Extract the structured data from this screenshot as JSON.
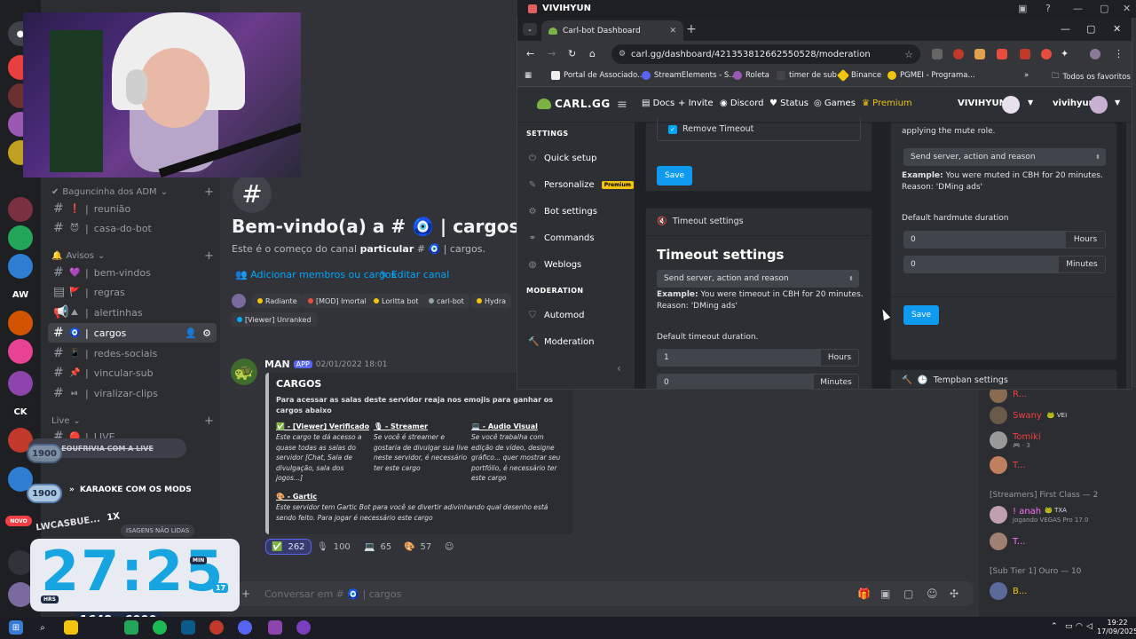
{
  "stream_bar": {
    "title": "VIVIHYUN"
  },
  "chrome": {
    "tab_title": "Carl-bot Dashboard",
    "url": "carl.gg/dashboard/421353812662550528/moderation",
    "bookmarks": [
      "Portal de Associado...",
      "StreamElements - S...",
      "Roleta",
      "timer de sub",
      "Binance",
      "PGMEI - Programa..."
    ],
    "all_bookmarks": "Todos os favoritos"
  },
  "carl": {
    "logo": "CARL.GG",
    "nav": {
      "docs": "Docs",
      "invite": "Invite",
      "discord": "Discord",
      "status": "Status",
      "games": "Games",
      "premium": "Premium"
    },
    "server_name": "VIVIHYUN",
    "user_name": "vivihyun",
    "sidebar": {
      "settings_heading": "SETTINGS",
      "items": [
        {
          "label": "Quick setup",
          "icon": "power-icon"
        },
        {
          "label": "Personalize",
          "icon": "pencil-icon",
          "badge": "Premium"
        },
        {
          "label": "Bot settings",
          "icon": "robot-icon"
        },
        {
          "label": "Commands",
          "icon": "link-icon"
        },
        {
          "label": "Weblogs",
          "icon": "globe-icon"
        }
      ],
      "moderation_heading": "MODERATION",
      "mod_items": [
        {
          "label": "Automod",
          "icon": "shield-icon"
        },
        {
          "label": "Moderation",
          "icon": "hammer-icon"
        }
      ]
    },
    "left_card": {
      "checkbox_label": "Remove Timeout",
      "save_label": "Save",
      "section_header": "Timeout settings",
      "title": "Timeout settings",
      "select_value": "Send server, action and reason",
      "example_prefix": "Example:",
      "example_text": "You were timeout in CBH for 20 minutes.",
      "example_reason": "Reason: 'DMing ads'",
      "duration_label": "Default timeout duration.",
      "hours_value": "1",
      "hours_unit": "Hours",
      "minutes_value": "0",
      "minutes_unit": "Minutes"
    },
    "right_card": {
      "intro": "applying the mute role.",
      "select_value": "Send server, action and reason",
      "example_prefix": "Example:",
      "example_text": "You were muted in CBH for 20 minutes.",
      "example_reason": "Reason: 'DMing ads'",
      "duration_label": "Default hardmute duration",
      "hours_value": "0",
      "hours_unit": "Hours",
      "minutes_value": "0",
      "minutes_unit": "Minutes",
      "save_label": "Save",
      "next_section": "Tempban settings"
    }
  },
  "discord": {
    "categories": {
      "adm": "Baguncinha dos ADM",
      "avisos": "Avisos",
      "live": "Live"
    },
    "channels_adm": [
      {
        "emoji": "❗",
        "name": "reunião"
      },
      {
        "emoji": "😈",
        "name": "casa-do-bot"
      }
    ],
    "channels_avisos": [
      {
        "emoji": "💜",
        "name": "bem-vindos"
      },
      {
        "emoji": "🚩",
        "name": "regras"
      },
      {
        "emoji": "⛰",
        "name": "alertinhas"
      },
      {
        "emoji": "🧿",
        "name": "cargos"
      },
      {
        "emoji": "📱",
        "name": "redes-sociais"
      },
      {
        "emoji": "📌",
        "name": "vincular-sub"
      },
      {
        "emoji": "⏯",
        "name": "viralizar-clips"
      }
    ],
    "channels_live": [
      {
        "emoji": "🔴",
        "name": "LIVE"
      }
    ],
    "welcome_title": "Bem-vindo(a) a # 🧿 | cargos!",
    "welcome_sub_prefix": "Este é o começo do canal",
    "welcome_sub_bold": "particular",
    "welcome_sub_suffix": "# 🧿 | cargos.",
    "add_members": "Adicionar membros ou cargos",
    "edit_channel": "Editar canal",
    "roles": [
      {
        "name": "Radiante",
        "color": "#f1c40f"
      },
      {
        "name": "[MOD] Imortal",
        "color": "#e74c3c"
      },
      {
        "name": "Loritta bot",
        "color": "#f1c40f"
      },
      {
        "name": "carl-bot",
        "color": "#95a5a6"
      },
      {
        "name": "Hydra",
        "color": "#f1c40f"
      },
      {
        "name": "[Viewer] Unranked",
        "color": "#00a8fc"
      }
    ],
    "message": {
      "author": "MAN",
      "app_badge": "APP",
      "date": "02/01/2022 18:01",
      "embed_title": "CARGOS",
      "embed_desc": "Para acessar as salas deste servidor reaja nos emojis para ganhar os cargos abaixo",
      "fields": [
        {
          "title": "✅ - [Viewer] Verificado",
          "text": "Este cargo te dá acesso a quase todas as salas do servidor [Chat, Sala de divulgação, sala dos jogos...]"
        },
        {
          "title": "🎙 - Streamer",
          "text": "Se você é streamer e gostaria de divulgar sua live neste servidor, é necessário ter este cargo"
        },
        {
          "title": "💻 - Audio Visual",
          "text": "Se você trabalha com edição de vídeo, designe gráfico... quer mostrar seu portfólio, é necessário ter este cargo"
        },
        {
          "title": "🎨 - Gartic",
          "text": "Este servidor tem Gartic Bot para você se divertir adivinhando qual desenho está sendo feito. Para jogar é necessário este cargo"
        }
      ],
      "reactions": [
        {
          "emoji": "✅",
          "count": "262"
        },
        {
          "emoji": "🎙",
          "count": "100"
        },
        {
          "emoji": "💻",
          "count": "65"
        },
        {
          "emoji": "🎨",
          "count": "57"
        }
      ]
    },
    "composer_placeholder": "Conversar em # 🧿 | cargos",
    "members": {
      "top_partial": "R...",
      "list1": [
        {
          "name": "Swany",
          "tag": "🐸 VEI",
          "color": "#f23f43"
        },
        {
          "name": "Tomiki",
          "status": "🎮 · 3",
          "color": "#f23f43"
        },
        {
          "name": "T...",
          "color": "#f23f43"
        }
      ],
      "heading_streamers": "[Streamers] First Class — 2",
      "list2": [
        {
          "name": "! anah",
          "tag": "🐸 TXA",
          "status": "Jogando VEGAS Pro 17.0",
          "color": "#ff73fa"
        },
        {
          "name": "T...",
          "color": "#ff73fa"
        }
      ],
      "heading_sub": "[Sub Tier 1] Ouro — 10",
      "list3": [
        {
          "name": "B...",
          "color": "#f1c40f"
        }
      ]
    }
  },
  "overlay": {
    "alert_text": "EOUFRIVIA COM A LIVE",
    "alert_badge": "1900",
    "karaoke_badge": "1900",
    "karaoke_text": "KARAOKE COM OS MODS",
    "new_tag": "NOVO",
    "lwc_name": "LWCASBUE...",
    "lwc_mult": "1X",
    "unread": "ISAGENS NÃO LIDAS",
    "timer": "27:25",
    "timer_min_tag": "MIN",
    "timer_hrs_tag": "HRS",
    "timer_small": "17",
    "counter": "1648 : 6000"
  },
  "taskbar": {
    "time": "19:22",
    "date": "17/09/2025"
  }
}
